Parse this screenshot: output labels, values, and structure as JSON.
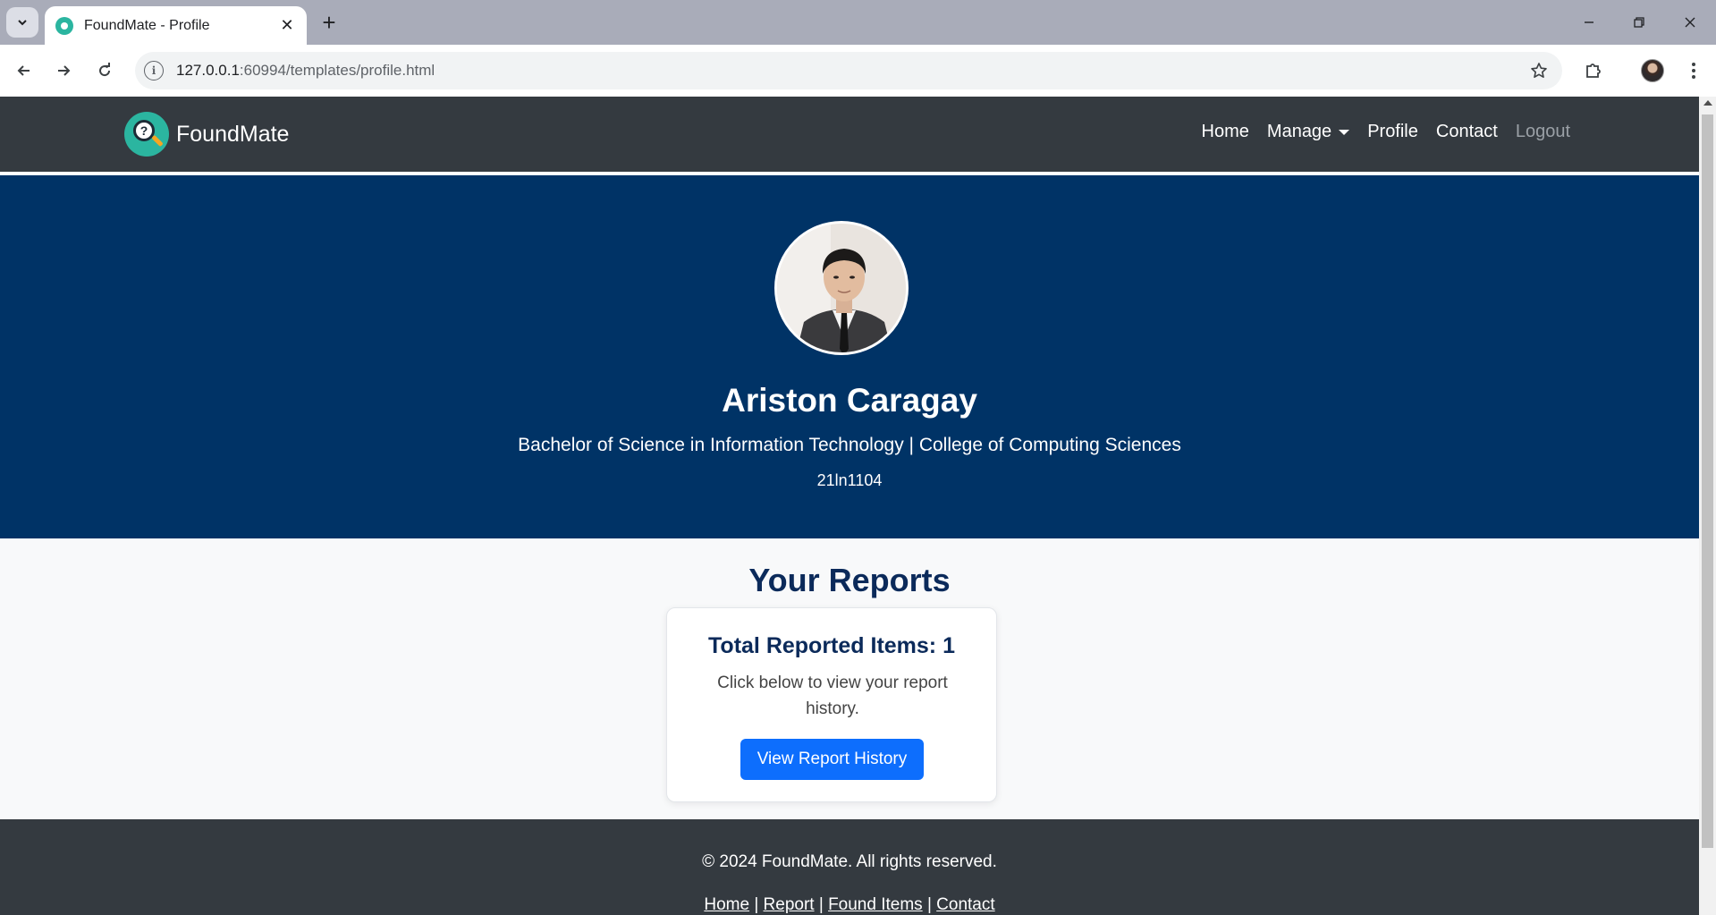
{
  "browser": {
    "tab_title": "FoundMate - Profile",
    "url_host": "127.0.0.1",
    "url_rest": ":60994/templates/profile.html"
  },
  "navbar": {
    "brand": "FoundMate",
    "links": {
      "home": "Home",
      "manage": "Manage",
      "profile": "Profile",
      "contact": "Contact",
      "logout": "Logout"
    }
  },
  "profile": {
    "name": "Ariston Caragay",
    "program": "Bachelor of Science in Information Technology | College of Computing Sciences",
    "student_id": "21ln1104"
  },
  "reports": {
    "title": "Your Reports",
    "card_title": "Total Reported Items: 1",
    "card_text": "Click below to view your report history.",
    "button": "View Report History"
  },
  "footer": {
    "copyright": "© 2024 FoundMate. All rights reserved.",
    "links": {
      "home": "Home",
      "report": "Report",
      "found_items": "Found Items",
      "contact": "Contact"
    },
    "separator": "|"
  },
  "colors": {
    "navbar": "#343a40",
    "hero": "#003366",
    "accent": "#0d6efd",
    "heading": "#0b2a5a",
    "logo": "#2bb5a0"
  }
}
